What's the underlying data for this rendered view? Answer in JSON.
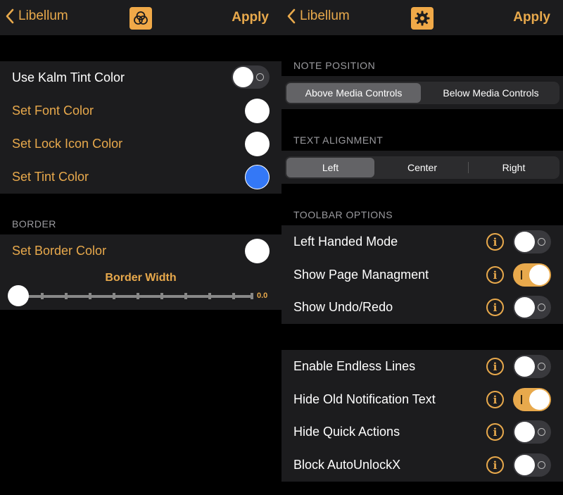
{
  "left": {
    "nav": {
      "back_label": "Libellum",
      "apply_label": "Apply",
      "icon": "color-circles-icon"
    },
    "rows": [
      {
        "label": "Use Kalm Tint Color",
        "type": "toggle",
        "on": false
      },
      {
        "label": "Set Font Color",
        "type": "color",
        "color": "#ffffff"
      },
      {
        "label": "Set Lock Icon Color",
        "type": "color",
        "color": "#ffffff"
      },
      {
        "label": "Set Tint Color",
        "type": "color",
        "color": "#3478f6"
      }
    ],
    "border": {
      "header": "BORDER",
      "set_border_color_label": "Set Border Color",
      "border_color": "#ffffff",
      "slider_title": "Border Width",
      "slider_value": "0.0"
    }
  },
  "right": {
    "nav": {
      "back_label": "Libellum",
      "apply_label": "Apply",
      "icon": "gear-icon"
    },
    "note_position": {
      "header": "NOTE POSITION",
      "options": [
        "Above Media Controls",
        "Below Media Controls"
      ],
      "selected": 0
    },
    "text_alignment": {
      "header": "TEXT ALIGNMENT",
      "options": [
        "Left",
        "Center",
        "Right"
      ],
      "selected": 0
    },
    "toolbar": {
      "header": "TOOLBAR OPTIONS",
      "rows": [
        {
          "label": "Left Handed Mode",
          "on": false
        },
        {
          "label": "Show Page Managment",
          "on": true
        },
        {
          "label": "Show Undo/Redo",
          "on": false
        }
      ]
    },
    "misc": {
      "rows": [
        {
          "label": "Enable Endless Lines",
          "on": false
        },
        {
          "label": "Hide Old Notification Text",
          "on": true
        },
        {
          "label": "Hide Quick Actions",
          "on": false
        },
        {
          "label": "Block AutoUnlockX",
          "on": false
        }
      ]
    }
  },
  "colors": {
    "accent": "#e8a94c",
    "group_bg": "#1c1c1e",
    "background": "#000000"
  }
}
